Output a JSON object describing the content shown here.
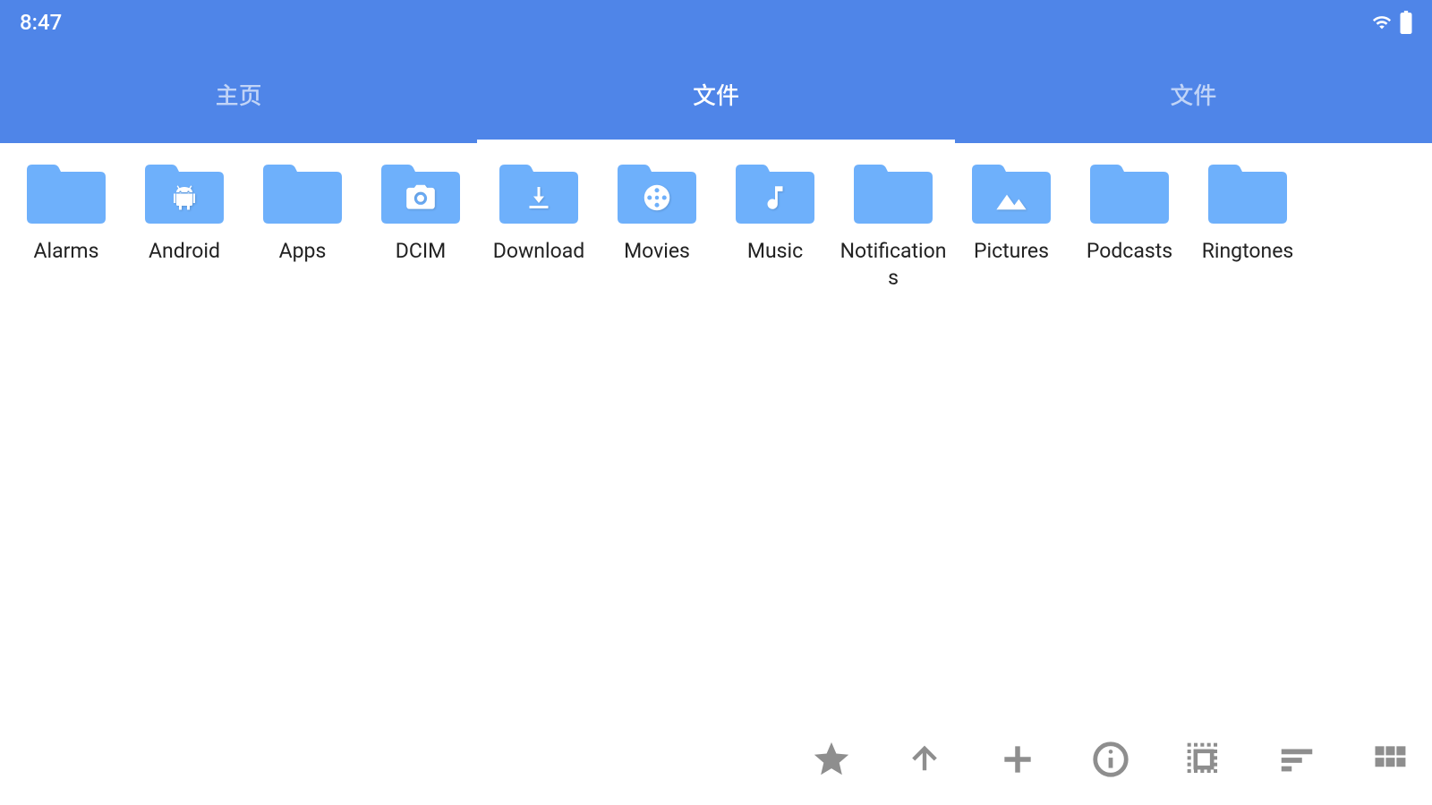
{
  "status": {
    "time": "8:47"
  },
  "tabs": [
    {
      "label": "主页",
      "active": false
    },
    {
      "label": "文件",
      "active": true
    },
    {
      "label": "文件",
      "active": false
    }
  ],
  "folders": [
    {
      "name": "Alarms",
      "icon": null
    },
    {
      "name": "Android",
      "icon": "android"
    },
    {
      "name": "Apps",
      "icon": null
    },
    {
      "name": "DCIM",
      "icon": "camera"
    },
    {
      "name": "Download",
      "icon": "download"
    },
    {
      "name": "Movies",
      "icon": "movie"
    },
    {
      "name": "Music",
      "icon": "music"
    },
    {
      "name": "Notifications",
      "icon": null
    },
    {
      "name": "Pictures",
      "icon": "image"
    },
    {
      "name": "Podcasts",
      "icon": null
    },
    {
      "name": "Ringtones",
      "icon": null
    }
  ],
  "toolbar": {
    "favorite": "favorite",
    "up": "up",
    "add": "add",
    "info": "info",
    "select_all": "select-all",
    "sort": "sort",
    "view": "grid-view"
  },
  "colors": {
    "header": "#4f85e8",
    "folder": "#6eb0fb",
    "folder_tab": "#6eb0fb",
    "icon_overlay": "#ffffff",
    "toolbar_icon": "#8e8e8e"
  }
}
